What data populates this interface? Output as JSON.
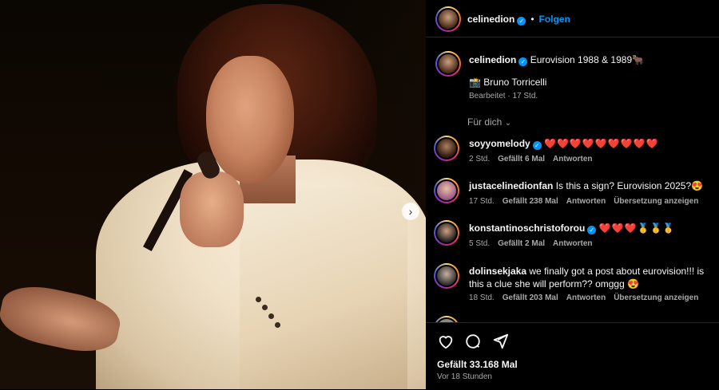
{
  "post": {
    "username": "celinedion",
    "follow_label": "Folgen",
    "separator": "•",
    "caption_text": "Eurovision 1988 & 1989🐂",
    "credit": "📸 Bruno Torricelli",
    "edited": "Bearbeitet · 17 Std.",
    "for_you": "Für dich",
    "likes": "Gefällt 33.168 Mal",
    "time_ago": "Vor 18 Stunden"
  },
  "comments": [
    {
      "user": "soyyomelody",
      "verified": true,
      "text": "❤️❤️❤️❤️❤️❤️❤️❤️❤️",
      "time": "2 Std.",
      "likes": "Gefällt 6 Mal",
      "reply": "Antworten",
      "translate": ""
    },
    {
      "user": "justacelinedionfan",
      "verified": false,
      "text": "Is this a sign? Eurovision 2025?😍",
      "time": "17 Std.",
      "likes": "Gefällt 238 Mal",
      "reply": "Antworten",
      "translate": "Übersetzung anzeigen"
    },
    {
      "user": "konstantinoschristoforou",
      "verified": true,
      "text": "❤️❤️❤️🥇🥇🥇",
      "time": "5 Std.",
      "likes": "Gefällt 2 Mal",
      "reply": "Antworten",
      "translate": ""
    },
    {
      "user": "dolinsekjaka",
      "verified": false,
      "text": "we finally got a post about eurovision!!! is this a clue she will perform?? omggg 😍",
      "time": "18 Std.",
      "likes": "Gefällt 203 Mal",
      "reply": "Antworten",
      "translate": "Übersetzung anzeigen"
    },
    {
      "user": "",
      "verified": false,
      "text": "",
      "time": "",
      "likes": "",
      "reply": "",
      "translate": ""
    }
  ],
  "icons": {
    "like": "heart-icon",
    "comment": "comment-icon",
    "share": "share-icon",
    "next": "chevron-right-icon",
    "dropdown": "chevron-down-icon"
  },
  "colors": {
    "link": "#0095f6",
    "verified": "#0095f6",
    "muted": "#a8a8a8",
    "background": "#000000"
  }
}
